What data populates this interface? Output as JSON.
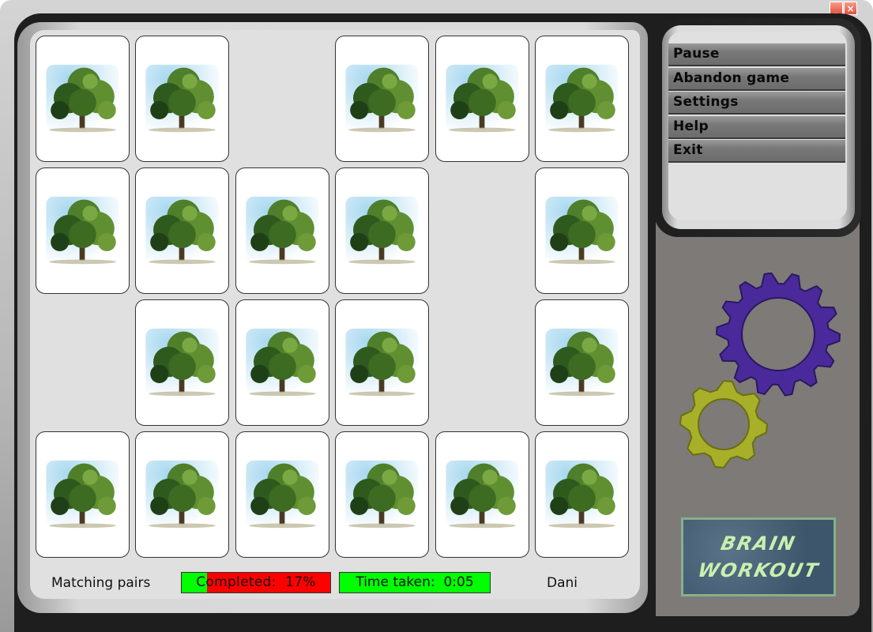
{
  "window": {
    "minimize_label": "_",
    "close_label": "×"
  },
  "board": {
    "rows": 4,
    "columns": 6,
    "card_face": "tree-card-back",
    "cards": [
      [
        true,
        true,
        false,
        true,
        true,
        true
      ],
      [
        true,
        true,
        true,
        true,
        false,
        true
      ],
      [
        false,
        true,
        true,
        true,
        false,
        true
      ],
      [
        true,
        true,
        true,
        true,
        true,
        true
      ]
    ]
  },
  "status_bar": {
    "game_mode": "Matching pairs",
    "completed_label": "Completed:",
    "completed_value": "17%",
    "completed_fraction": 0.17,
    "time_label": "Time taken:",
    "time_value": "0:05",
    "player_name": "Dani"
  },
  "menu": {
    "items": [
      {
        "label": "Pause"
      },
      {
        "label": "Abandon game"
      },
      {
        "label": "Settings"
      },
      {
        "label": "Help"
      },
      {
        "label": "Exit"
      }
    ]
  },
  "logo": {
    "line1": "BRAIN",
    "line2": "WORKOUT"
  },
  "colors": {
    "progress_done": "#00ff00",
    "progress_remaining": "#ff0000",
    "gear_large": "#4a2a9a",
    "gear_small": "#a8b02a",
    "logo_text": "#c8f0b0"
  }
}
